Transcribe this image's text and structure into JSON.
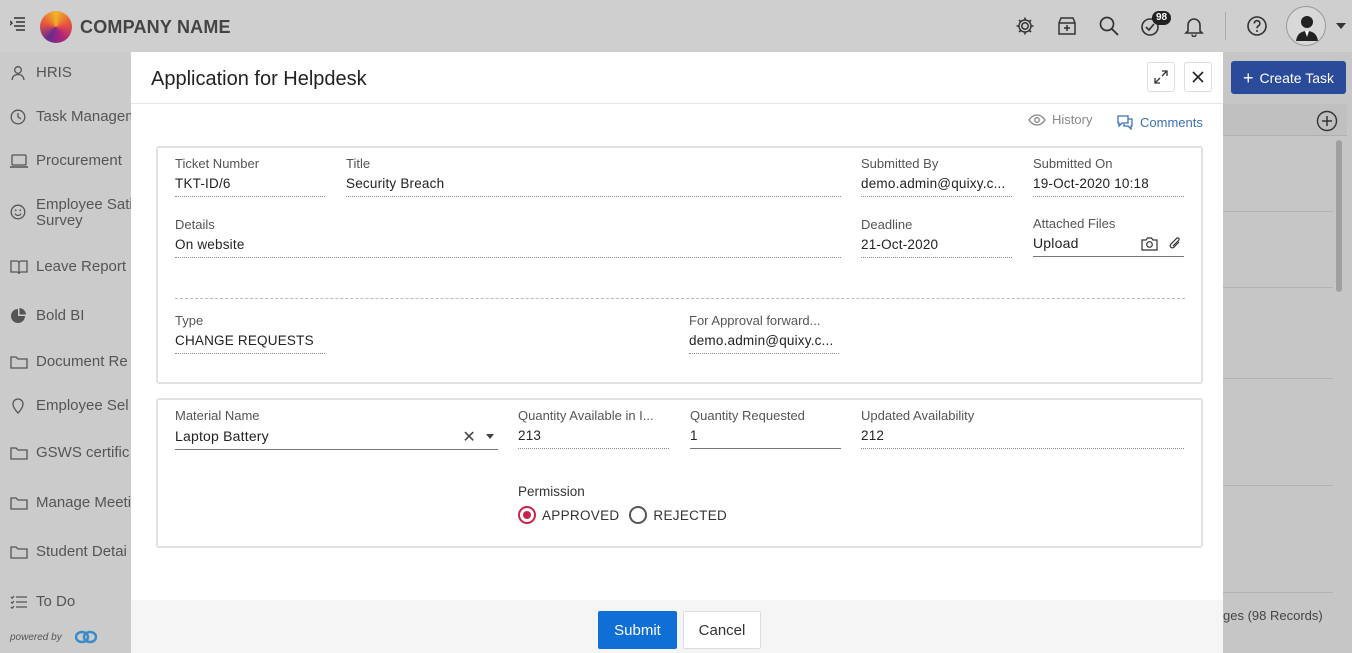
{
  "header": {
    "brand": "COMPANY NAME",
    "notification_count": "98"
  },
  "sidebar": {
    "items": [
      {
        "label": "HRIS",
        "icon": "user-icon"
      },
      {
        "label": "Task Managem",
        "icon": "clock-icon"
      },
      {
        "label": "Procurement",
        "icon": "laptop-icon"
      },
      {
        "label": "Employee Sati",
        "label2": "Survey",
        "icon": "smiley-icon"
      },
      {
        "label": "Leave Report",
        "icon": "book-icon"
      },
      {
        "label": "Bold BI",
        "icon": "pie-icon"
      },
      {
        "label": "Document Re",
        "icon": "folder-icon"
      },
      {
        "label": "Employee Sel",
        "icon": "location-icon"
      },
      {
        "label": "GSWS certific",
        "icon": "folder-icon"
      },
      {
        "label": "Manage Meeti",
        "icon": "folder-icon"
      },
      {
        "label": "Student Detai",
        "icon": "folder-icon"
      },
      {
        "label": "To Do",
        "icon": "checklist-icon"
      }
    ],
    "powered_by": "powered by"
  },
  "right_panel": {
    "create_task": "Create Task",
    "records": "ges (98 Records)"
  },
  "modal": {
    "title": "Application for Helpdesk",
    "history": "History",
    "comments": "Comments",
    "card1": {
      "ticket_number": {
        "label": "Ticket Number",
        "value": "TKT-ID/6"
      },
      "title": {
        "label": "Title",
        "value": "Security Breach"
      },
      "submitted_by": {
        "label": "Submitted By",
        "value": "demo.admin@quixy.c..."
      },
      "submitted_on": {
        "label": "Submitted On",
        "value": "19-Oct-2020 10:18"
      },
      "details": {
        "label": "Details",
        "value": "On website"
      },
      "deadline": {
        "label": "Deadline",
        "value": "21-Oct-2020"
      },
      "attached_files": {
        "label": "Attached Files",
        "value": "Upload"
      },
      "type": {
        "label": "Type",
        "value": "CHANGE REQUESTS"
      },
      "approval": {
        "label": "For Approval forward...",
        "value": "demo.admin@quixy.c..."
      }
    },
    "card2": {
      "material_name": {
        "label": "Material Name",
        "value": "Laptop Battery"
      },
      "qty_available": {
        "label": "Quantity Available in I...",
        "value": "213"
      },
      "qty_requested": {
        "label": "Quantity Requested",
        "value": "1"
      },
      "updated_availability": {
        "label": "Updated Availability",
        "value": "212"
      },
      "permission": {
        "label": "Permission",
        "options": [
          "APPROVED",
          "REJECTED"
        ],
        "selected": "APPROVED"
      }
    },
    "buttons": {
      "submit": "Submit",
      "cancel": "Cancel"
    }
  },
  "colors": {
    "primary_button": "#0f6fd6",
    "create_task": "#2a4a9a",
    "radio_selected": "#c8234b",
    "link": "#3b6fb6"
  }
}
